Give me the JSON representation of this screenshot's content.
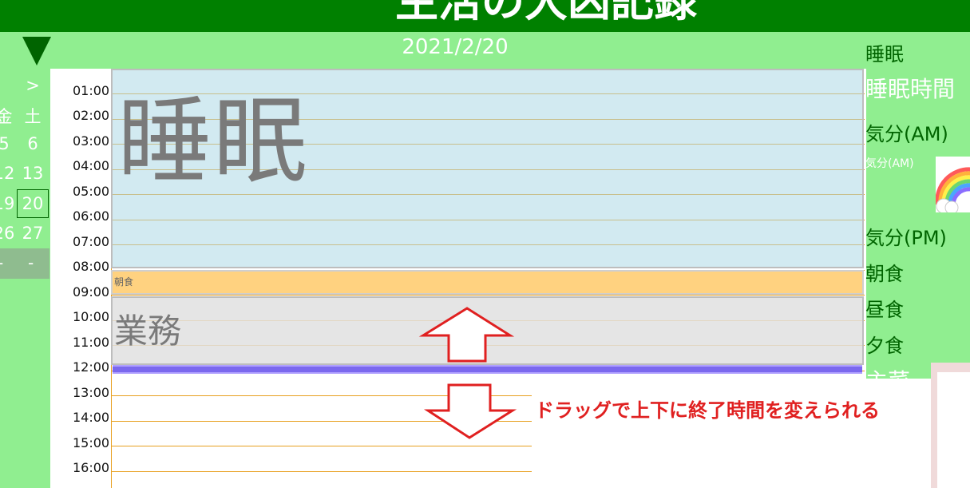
{
  "app": {
    "title": "生活の大凶記録"
  },
  "date": "2021/2/20",
  "calendar": {
    "prev_label": ">",
    "days_header": [
      "金",
      "土"
    ],
    "rows": [
      [
        "5",
        "6"
      ],
      [
        "12",
        "13"
      ],
      [
        "19",
        "20"
      ],
      [
        "26",
        "27"
      ],
      [
        "-",
        "-"
      ]
    ],
    "selected": "20"
  },
  "timeline": {
    "hours": [
      "01:00",
      "02:00",
      "03:00",
      "04:00",
      "05:00",
      "06:00",
      "07:00",
      "08:00",
      "09:00",
      "10:00",
      "11:00",
      "12:00",
      "13:00",
      "14:00",
      "15:00",
      "16:00"
    ],
    "events": {
      "sleep": "睡眠",
      "breakfast": "朝食",
      "work": "業務"
    }
  },
  "annotation": "ドラッグで上下に終了時間を変えられる",
  "sidebar": {
    "sleep": "睡眠",
    "sleep_time": "睡眠時間",
    "mood_am": "気分(AM)",
    "mood_am_small": "気分(AM)",
    "mood_pm": "気分(PM)",
    "breakfast": "朝食",
    "lunch": "昼食",
    "dinner": "夕食",
    "main_dish": "主菜"
  },
  "colors": {
    "header": "#008000",
    "background": "#90ee90",
    "sleep_block": "#d4eaf2",
    "breakfast_block": "#ffd280",
    "handle": "#7b68ee",
    "arrow": "#e02020"
  }
}
